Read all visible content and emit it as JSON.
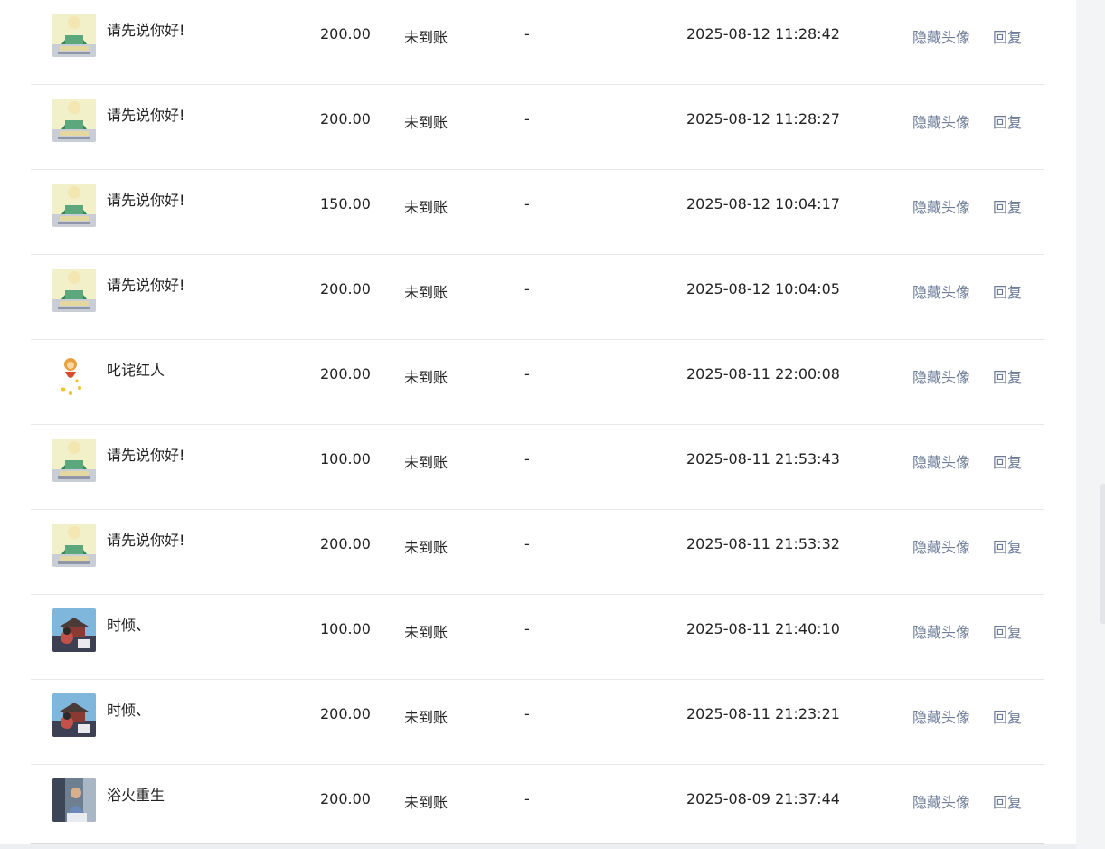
{
  "columns_actions": {
    "hide_avatar": "隐藏头像",
    "reply": "回复"
  },
  "rows": [
    {
      "name": "请先说你好!",
      "avatar": "green-figure-avatar",
      "amount": "200.00",
      "status": "未到账",
      "remark": "-",
      "time": "2025-08-12 11:28:42"
    },
    {
      "name": "请先说你好!",
      "avatar": "green-figure-avatar",
      "amount": "200.00",
      "status": "未到账",
      "remark": "-",
      "time": "2025-08-12 11:28:27"
    },
    {
      "name": "请先说你好!",
      "avatar": "green-figure-avatar",
      "amount": "150.00",
      "status": "未到账",
      "remark": "-",
      "time": "2025-08-12 10:04:17"
    },
    {
      "name": "请先说你好!",
      "avatar": "green-figure-avatar",
      "amount": "200.00",
      "status": "未到账",
      "remark": "-",
      "time": "2025-08-12 10:04:05"
    },
    {
      "name": "叱诧红人",
      "avatar": "monkey-cartoon-avatar",
      "amount": "200.00",
      "status": "未到账",
      "remark": "-",
      "time": "2025-08-11 22:00:08"
    },
    {
      "name": "请先说你好!",
      "avatar": "green-figure-avatar",
      "amount": "100.00",
      "status": "未到账",
      "remark": "-",
      "time": "2025-08-11 21:53:43"
    },
    {
      "name": "请先说你好!",
      "avatar": "green-figure-avatar",
      "amount": "200.00",
      "status": "未到账",
      "remark": "-",
      "time": "2025-08-11 21:53:32"
    },
    {
      "name": "时倾、",
      "avatar": "temple-photo-avatar",
      "amount": "100.00",
      "status": "未到账",
      "remark": "-",
      "time": "2025-08-11 21:40:10"
    },
    {
      "name": "时倾、",
      "avatar": "temple-photo-avatar",
      "amount": "200.00",
      "status": "未到账",
      "remark": "-",
      "time": "2025-08-11 21:23:21"
    },
    {
      "name": "浴火重生",
      "avatar": "person-photo-avatar",
      "amount": "200.00",
      "status": "未到账",
      "remark": "-",
      "time": "2025-08-09 21:37:44"
    }
  ],
  "colors": {
    "action_link": "#6d7c98",
    "row_divider": "#e8e8e8",
    "text": "#222222"
  }
}
